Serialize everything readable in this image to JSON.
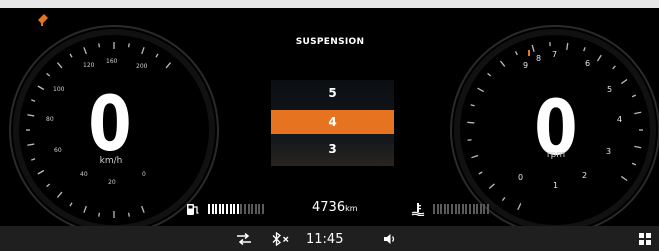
{
  "center": {
    "title": "SUSPENSION",
    "levels": [
      "5",
      "4",
      "3"
    ],
    "selected_level": "4"
  },
  "speedometer": {
    "value": "0",
    "unit": "km/h",
    "scale_labels": [
      "20",
      "40",
      "60",
      "80",
      "100",
      "120",
      "160",
      "200",
      "0"
    ]
  },
  "tachometer": {
    "value": "0",
    "unit": "rpm",
    "scale_labels": [
      "0",
      "1",
      "2",
      "3",
      "4",
      "5",
      "6",
      "7",
      "8",
      "9"
    ]
  },
  "status": {
    "fuel_icon": "fuel-pump-icon",
    "fuel_level": 0.55,
    "odometer_value": "4736",
    "odometer_unit": "km",
    "coolant_icon": "coolant-temperature-icon",
    "coolant_level": 0.0
  },
  "bottom_bar": {
    "drive_icon": "drive-mode-icon",
    "bluetooth_icon": "bluetooth-off-icon",
    "time": "11:45",
    "volume_icon": "volume-icon",
    "apps_icon": "grid-apps-icon"
  },
  "colors": {
    "accent": "#e5731f",
    "background": "#000000",
    "bottom_bar": "#1f1f1f",
    "inactive_bar": "#5a5a5a"
  }
}
